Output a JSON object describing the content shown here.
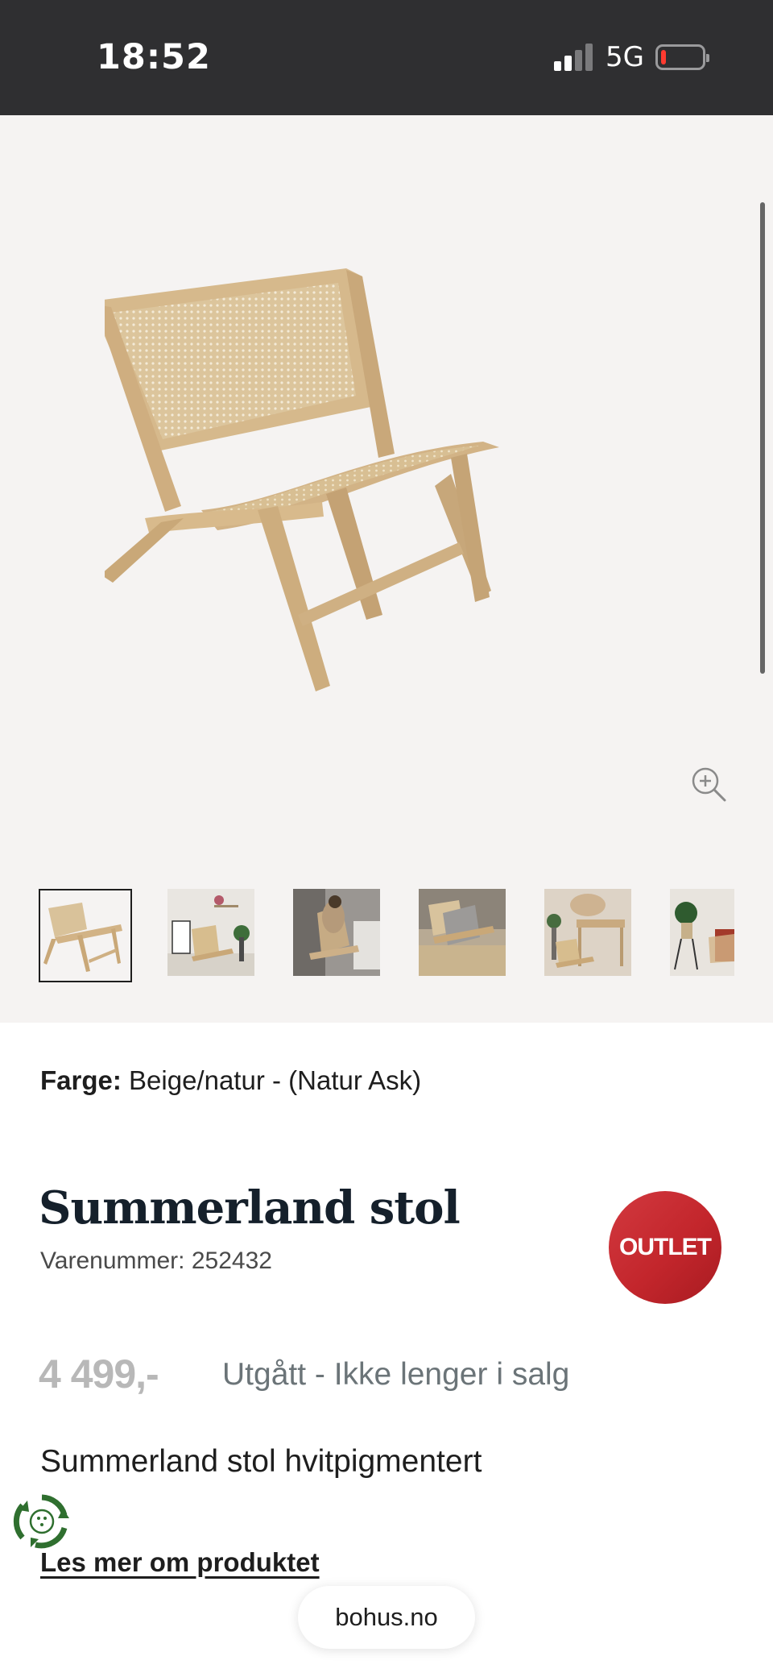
{
  "status_bar": {
    "time": "18:52",
    "network": "5G",
    "signal_bars": 2,
    "battery_level": 0.12,
    "battery_color": "#ff3b30"
  },
  "gallery": {
    "main_image_icon": "lounge-chair-image",
    "zoom_icon": "zoom-in-icon",
    "thumbnails": [
      {
        "icon": "chair-product-thumbnail",
        "active": true
      },
      {
        "icon": "chair-room-thumbnail",
        "active": false
      },
      {
        "icon": "chair-person-thumbnail",
        "active": false
      },
      {
        "icon": "chair-outdoor-thumbnail",
        "active": false
      },
      {
        "icon": "chair-desk-thumbnail",
        "active": false
      },
      {
        "icon": "chair-plant-thumbnail",
        "active": false
      }
    ]
  },
  "product": {
    "color_label": "Farge:",
    "color_value": "Beige/natur - (Natur Ask)",
    "title": "Summerland stol",
    "sku": "Varenummer: 252432",
    "badge": "OUTLET",
    "price": "4 499,-",
    "availability": "Utgått - Ikke lenger i salg",
    "short_description": "Summerland stol hvitpigmentert",
    "read_more": "Les mer om produktet"
  },
  "browser": {
    "url": "bohus.no"
  },
  "colors": {
    "status_bar_bg": "#2f2f31",
    "gallery_bg": "#f5f3f2",
    "outlet_red": "#c3262c",
    "eco_green": "#2f6f2f",
    "title_color": "#15202b"
  }
}
